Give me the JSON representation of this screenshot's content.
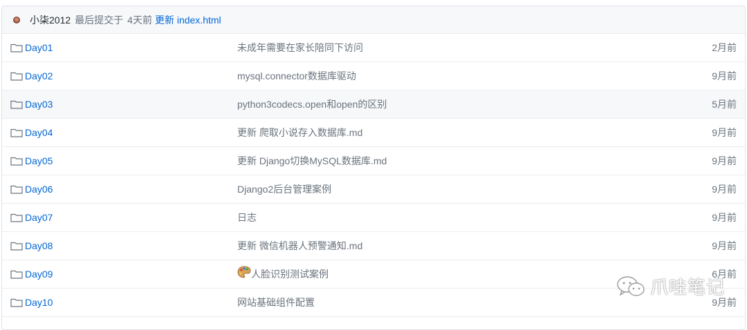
{
  "commit": {
    "author": "小柒2012",
    "meta": "最后提交于",
    "time": "4天前",
    "message": "更新 index.html"
  },
  "files": [
    {
      "name": "Day01",
      "message": "未成年需要在家长陪同下访问",
      "date": "2月前"
    },
    {
      "name": "Day02",
      "message": "mysql.connector数据库驱动",
      "date": "9月前"
    },
    {
      "name": "Day03",
      "message": "python3codecs.open和open的区别",
      "date": "5月前"
    },
    {
      "name": "Day04",
      "message": "更新 爬取小说存入数据库.md",
      "date": "9月前"
    },
    {
      "name": "Day05",
      "message": "更新 Django切换MySQL数据库.md",
      "date": "9月前"
    },
    {
      "name": "Day06",
      "message": "Django2后台管理案例",
      "date": "9月前"
    },
    {
      "name": "Day07",
      "message": "日志",
      "date": "9月前"
    },
    {
      "name": "Day08",
      "message": "更新 微信机器人预警通知.md",
      "date": "9月前"
    },
    {
      "name": "Day09",
      "message": "人脸识别测试案例",
      "date": "6月前",
      "icon": "palette-icon"
    },
    {
      "name": "Day10",
      "message": "网站基础组件配置",
      "date": "9月前"
    }
  ],
  "watermark": {
    "text": "爪哇笔记",
    "icon": "wechat-icon"
  },
  "colors": {
    "link": "#0366d6",
    "muted": "#6a737d",
    "header_bg": "#f6f8fa",
    "hover_bg": "#f6f8fa",
    "border": "#eaecef"
  }
}
